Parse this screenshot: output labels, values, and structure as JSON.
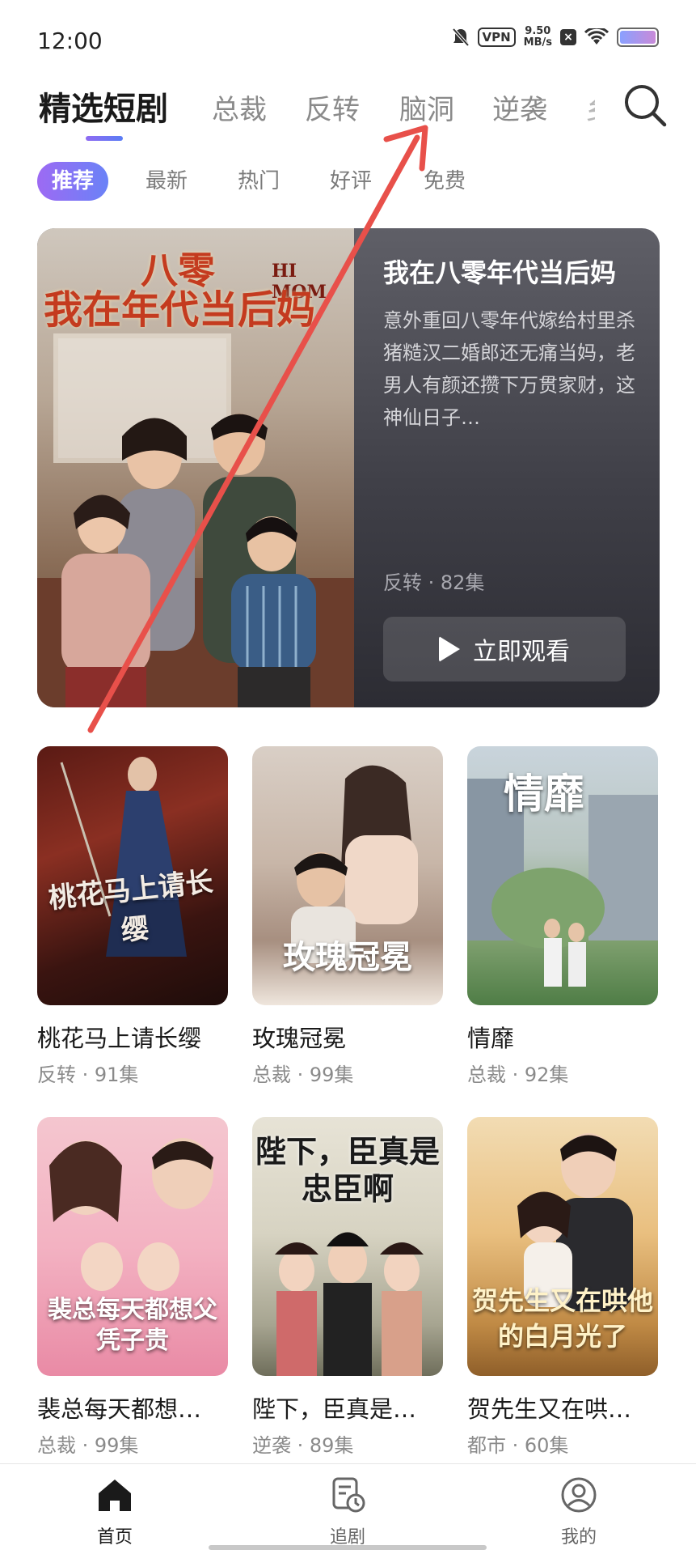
{
  "status_bar": {
    "time": "12:00",
    "vpn": "VPN",
    "net_speed_value": "9.50",
    "net_speed_unit": "MB/s"
  },
  "top_tabs": [
    "精选短剧",
    "总裁",
    "反转",
    "脑洞",
    "逆袭",
    "乡"
  ],
  "active_tab": "精选短剧",
  "chips": [
    "推荐",
    "最新",
    "热门",
    "好评",
    "免费"
  ],
  "active_chip": "推荐",
  "featured": {
    "poster_title_line1": "八零",
    "poster_title_line2": "我在年代当后妈",
    "poster_sign": "HI MOM",
    "title": "我在八零年代当后妈",
    "description": "意外重回八零年代嫁给村里杀猪糙汉二婚郎还无痛当妈，老男人有颜还攒下万贯家财，这神仙日子…",
    "meta": "反转 · 82集",
    "watch_button": "立即观看"
  },
  "grid": [
    {
      "title": "桃花马上请长缨",
      "meta": "反转 · 91集",
      "poster_text": "桃花马上请长缨"
    },
    {
      "title": "玫瑰冠冕",
      "meta": "总裁 · 99集",
      "poster_text": "玫瑰冠冕"
    },
    {
      "title": "情靡",
      "meta": "总裁 · 92集",
      "poster_text": "情靡"
    },
    {
      "title": "裴总每天都想…",
      "meta": "总裁 · 99集",
      "poster_text": "裴总每天都想父凭子贵"
    },
    {
      "title": "陛下，臣真是…",
      "meta": "逆袭 · 89集",
      "poster_text": "陛下，臣真是忠臣啊"
    },
    {
      "title": "贺先生又在哄…",
      "meta": "都市 · 60集",
      "poster_text": "贺先生又在哄他的白月光了"
    }
  ],
  "bottom_nav": [
    {
      "label": "首页",
      "icon": "home-icon"
    },
    {
      "label": "追剧",
      "icon": "history-icon"
    },
    {
      "label": "我的",
      "icon": "profile-icon"
    }
  ],
  "active_nav": "首页",
  "colors": {
    "accent_start": "#9d6af3",
    "accent_end": "#6a82f7",
    "annotation_arrow": "#e8504a"
  }
}
